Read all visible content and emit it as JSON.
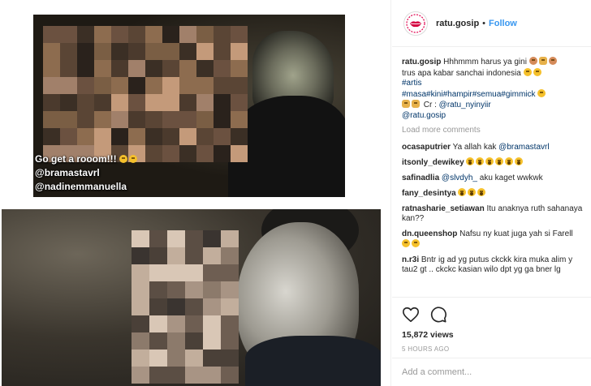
{
  "media": {
    "clip1_caption_lines": [
      "Go get a rooom!!!",
      "@bramastavrl",
      "@nadinemmanuella"
    ]
  },
  "header": {
    "username": "ratu.gosip",
    "separator": "•",
    "follow_label": "Follow"
  },
  "caption": {
    "username": "ratu.gosip",
    "line1": "Hhhmmm harus ya gini",
    "line2": "trus apa kabar sanchai indonesia",
    "tag1": "#artis",
    "tag_group": "#masa#kini#hampir#semua#gimmick",
    "credit_prefix": "Cr :",
    "credit_user": "@ratu_nyinyiir",
    "mention": "@ratu.gosip"
  },
  "load_more": "Load more comments",
  "comments": [
    {
      "user": "ocasaputrier",
      "text": "Ya allah kak",
      "mention": "@bramastavrl"
    },
    {
      "user": "itsonly_dewikey",
      "text": ""
    },
    {
      "user": "safinadlia",
      "mention": "@slvdyh_",
      "text": "aku kaget wwkwk"
    },
    {
      "user": "fany_desintya",
      "text": ""
    },
    {
      "user": "ratnasharie_setiawan",
      "text": "Itu anaknya ruth sahanaya kan??"
    },
    {
      "user": "dn.queenshop",
      "text": "Nafsu ny kuat juga yah si Farell"
    },
    {
      "user": "n.r3i",
      "text": "Bntr ig ad yg putus ckckk kira muka alim y tau2 gt .. ckckc kasian wilo dpt yg ga bner lg"
    }
  ],
  "stats": {
    "views": "15,872 views",
    "time_ago": "5 HOURS AGO"
  },
  "add_comment": {
    "placeholder": "Add a comment..."
  },
  "icons": {
    "like": "heart-icon",
    "comment": "comment-bubble-icon",
    "emoji": "emoji-icon"
  },
  "colors": {
    "link": "#3897f0",
    "tag": "#003569",
    "muted": "#999999",
    "text": "#262626"
  }
}
